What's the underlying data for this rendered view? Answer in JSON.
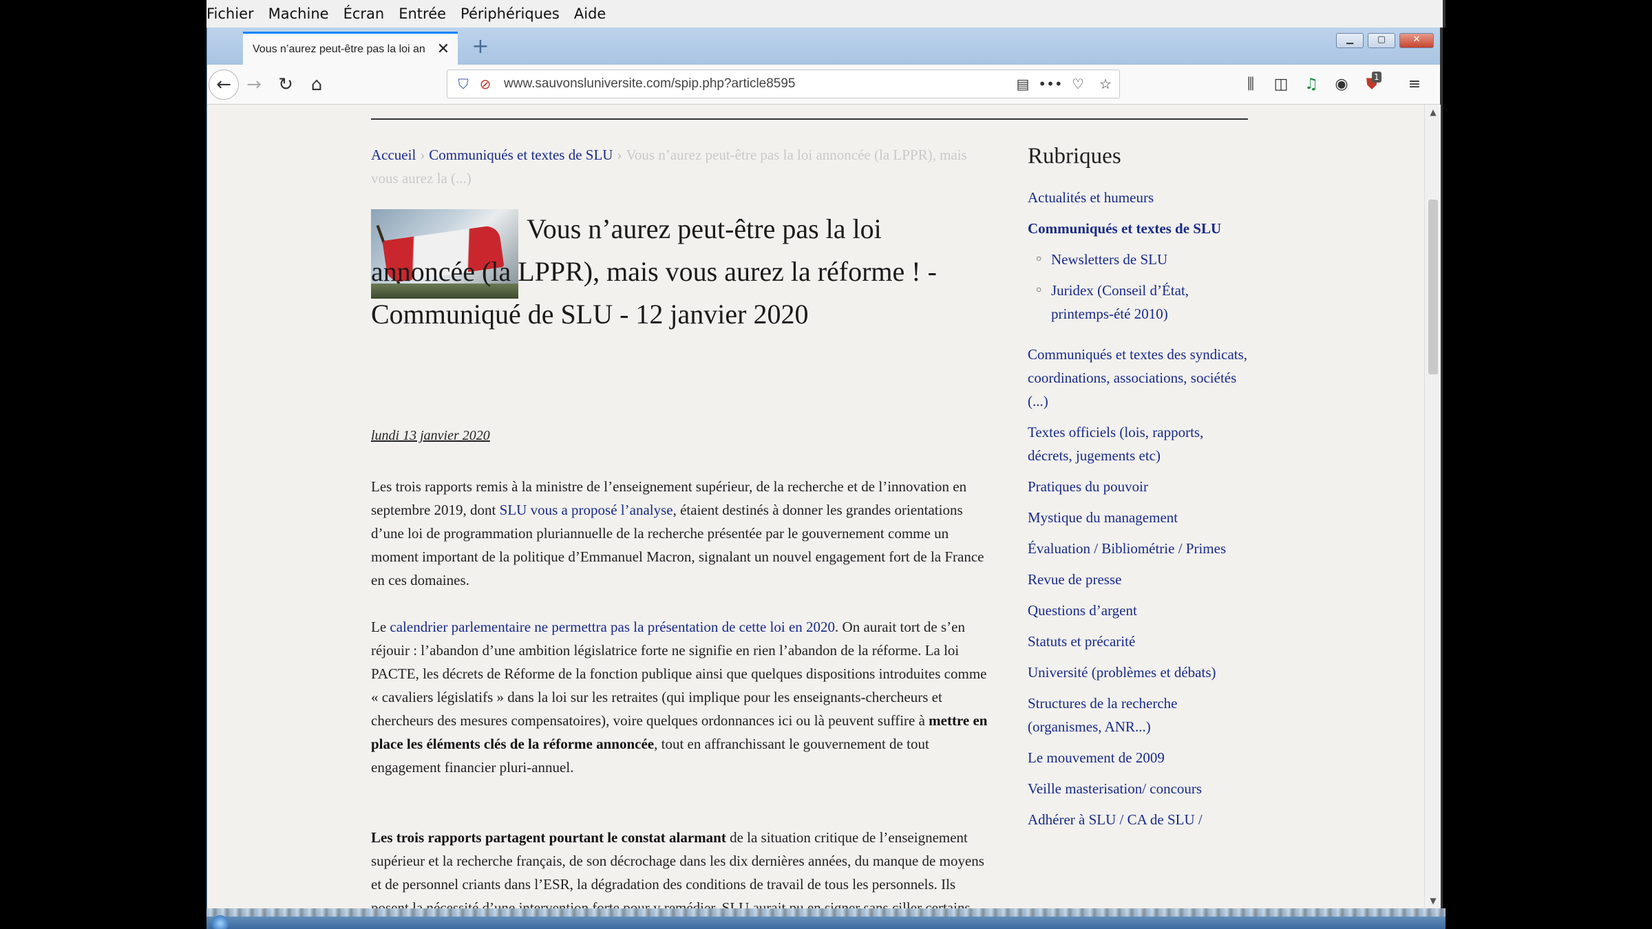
{
  "vm_menu": [
    "Fichier",
    "Machine",
    "Écran",
    "Entrée",
    "Périphériques",
    "Aide"
  ],
  "browser": {
    "tab_title": "Vous n’aurez peut-être pas la loi an",
    "url": "www.sauvonsluniversite.com/spip.php?article8595",
    "ublock_count": "1"
  },
  "breadcrumb": {
    "home": "Accueil",
    "section": "Communiqués et textes de SLU",
    "current": "Vous n’aurez peut-être pas la loi annoncée (la LPPR), mais vous aurez la (...)"
  },
  "article": {
    "title": "Vous n’aurez peut-être pas la loi annoncée (la LPPR), mais vous aurez la réforme ! - Communiqué de SLU - 12 janvier 2020",
    "date": "lundi 13 janvier 2020",
    "p1_a": "Les trois rapports remis à la ministre de l’enseignement supérieur, de la recherche et de l’innovation en septembre 2019, dont ",
    "p1_link": "SLU vous a proposé l’analyse",
    "p1_b": ", étaient destinés à donner les grandes orientations d’une loi de programmation pluriannuelle de la recherche présentée par le gouvernement comme un moment important de la politique d’Emmanuel Macron, signalant un nouvel engagement fort de la France en ces domaines.",
    "p2_a": "Le ",
    "p2_link": "calendrier parlementaire ne permettra pas la présentation de cette loi en 2020",
    "p2_b": ". On aurait tort de s’en réjouir : l’abandon d’une ambition législatrice forte ne signifie en rien l’abandon de la réforme. La loi PACTE, les décrets de Réforme de la fonction publique ainsi que quelques dispositions introduites comme « cavaliers législatifs » dans la loi sur les retraites (qui implique pour les enseignants-chercheurs et chercheurs des mesures compensatoires), voire quelques ordonnances ici ou là peuvent suffire à ",
    "p2_bold": "mettre en place les éléments clés de la réforme annoncée",
    "p2_c": ", tout en affranchissant le gouvernement de tout engagement financier pluri-annuel.",
    "p3_bold1": "Les ",
    "p3_link": "trois rapports",
    "p3_bold2": " partagent pourtant le constat alarmant",
    "p3_rest": " de la situation critique de l’enseignement supérieur et la recherche français, de son décrochage dans les dix dernières années, du manque de moyens et de personnel criants dans l’ESR, la dégradation des conditions de travail de tous les personnels. Ils posent la nécessité d’une intervention forte pour y remédier. SLU aurait pu en signer sans ciller certains"
  },
  "sidebar": {
    "title": "Rubriques",
    "items": [
      "Actualités et humeurs",
      "Communiqués et textes de SLU",
      "Newsletters de SLU",
      "Juridex (Conseil d’État, printemps-été 2010)",
      "Communiqués et textes des syndicats, coordinations, associations, sociétés (...)",
      "Textes officiels (lois, rapports, décrets, jugements etc)",
      "Pratiques du pouvoir",
      "Mystique du management",
      "Évaluation / Bibliométrie / Primes",
      "Revue de presse",
      "Questions d’argent",
      "Statuts et précarité",
      "Université (problèmes et débats)",
      "Structures de la recherche (organismes, ANR...)",
      "Le mouvement de 2009",
      "Veille masterisation/ concours",
      "Adhérer à SLU / CA de SLU /"
    ]
  },
  "colors": {
    "link": "#1a2a8a",
    "page_bg": "#f2f1ee",
    "tab_accent": "#0a84ff"
  }
}
